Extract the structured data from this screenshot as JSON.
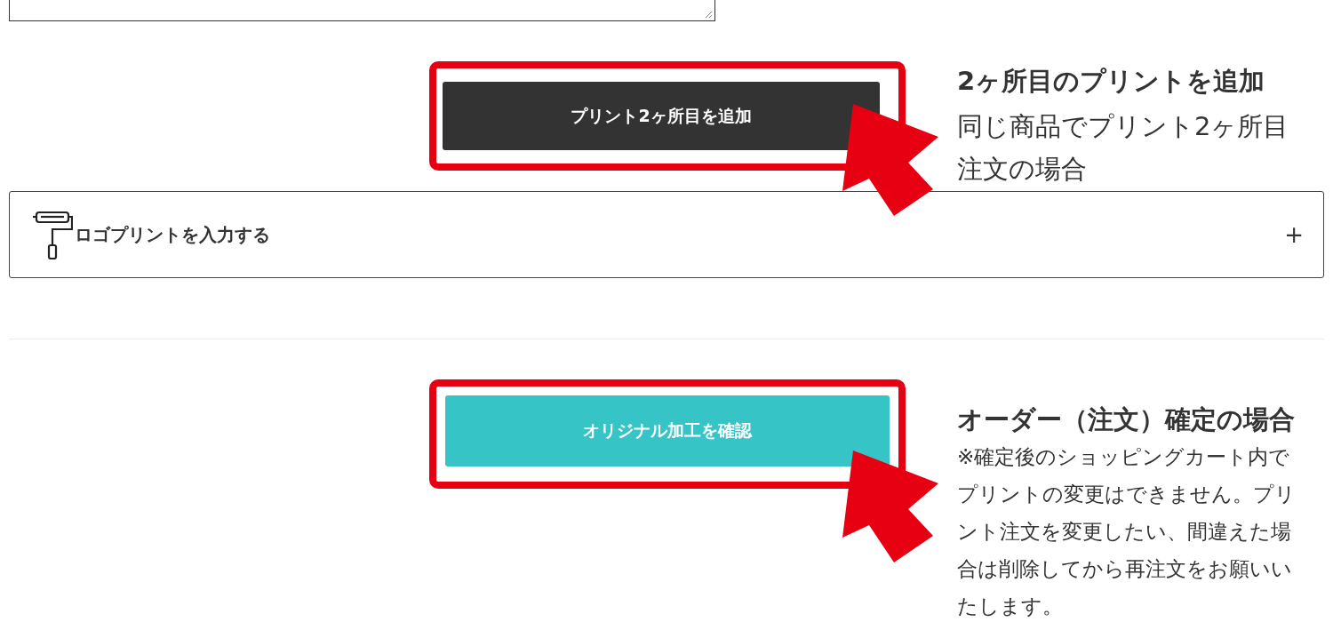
{
  "sections": [
    {
      "button": {
        "label": "プリント2ヶ所目を追加",
        "kind": "dark"
      },
      "note": {
        "title": "2ヶ所目のプリントを追加",
        "lines": [
          "同じ商品でプリント2ヶ所目",
          "注文の場合"
        ]
      }
    },
    {
      "button": {
        "label": "オリジナル加工を確認",
        "kind": "teal"
      },
      "note": {
        "title": "オーダー（注文）確定の場合",
        "lines": [
          "※確定後のショッピングカート内で",
          "プリントの変更はできません。プリ",
          "ント注文を変更したい、間違えた場",
          "合は削除してから再注文をお願いい",
          "たします。"
        ]
      }
    }
  ],
  "accordion": {
    "label": "ロゴプリントを入力する",
    "toggle": "+"
  }
}
